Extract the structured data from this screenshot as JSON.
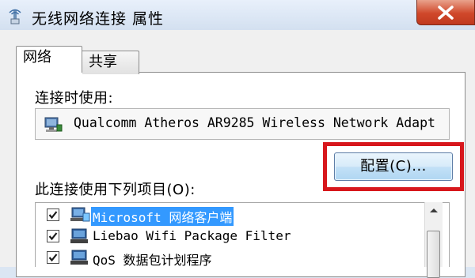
{
  "window": {
    "title": "无线网络连接 属性",
    "icon": "network-connection-icon",
    "close_icon": "close-icon"
  },
  "tabs": [
    {
      "label": "网络",
      "selected": true
    },
    {
      "label": "共享",
      "selected": false
    }
  ],
  "connect_using": {
    "label": "连接时使用:",
    "adapter": "Qualcomm Atheros AR9285 Wireless Network Adapt",
    "icon": "network-adapter-icon"
  },
  "configure_button": {
    "label": "配置(C)...",
    "highlight_color": "#d7171c"
  },
  "items": {
    "label": "此连接使用下列项目(O):",
    "list": [
      {
        "label": "Microsoft 网络客户端",
        "checked": true,
        "selected": true,
        "icon": "network-client-icon"
      },
      {
        "label": "Liebao Wifi Package Filter",
        "checked": true,
        "selected": false,
        "icon": "network-service-icon"
      },
      {
        "label": "QoS 数据包计划程序",
        "checked": true,
        "selected": false,
        "icon": "network-service-icon"
      }
    ]
  },
  "colors": {
    "selection": "#3399ff",
    "close_button": "#c0391f"
  }
}
